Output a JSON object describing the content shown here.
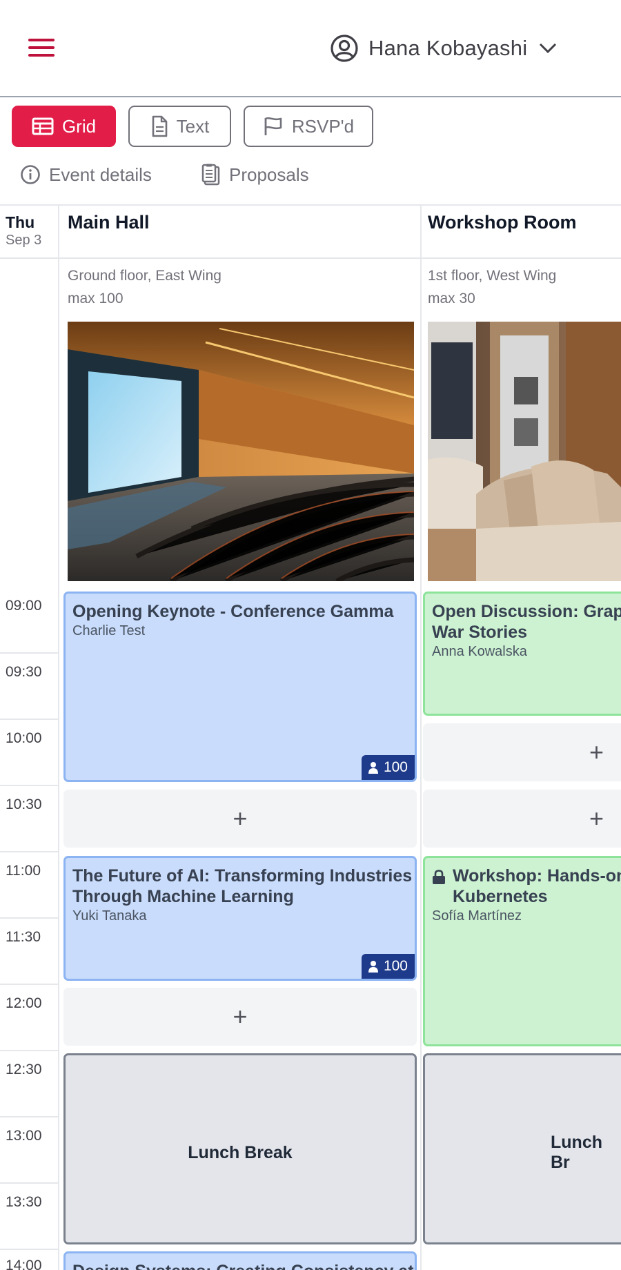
{
  "header": {
    "user_name": "Hana Kobayashi",
    "accent_color": "#e11d48"
  },
  "views": {
    "grid": "Grid",
    "text": "Text",
    "rsvpd": "RSVP'd"
  },
  "links": {
    "event_details": "Event details",
    "proposals": "Proposals"
  },
  "day": {
    "weekday": "Thu",
    "date": "Sep 3"
  },
  "rooms": [
    {
      "name": "Main Hall",
      "location": "Ground floor, East Wing",
      "capacity": "max 100",
      "photo": "auditorium"
    },
    {
      "name": "Workshop Room",
      "location": "1st floor, West Wing",
      "capacity": "max 30",
      "photo": "lounge"
    }
  ],
  "times": [
    "09:00",
    "09:30",
    "10:00",
    "10:30",
    "11:00",
    "11:30",
    "12:00",
    "12:30",
    "13:00",
    "13:30",
    "14:00"
  ],
  "events": {
    "keynote": {
      "title": "Opening Keynote - Conference Gamma",
      "speaker": "Charlie Test",
      "capacity": "100"
    },
    "discussion": {
      "title_line1": "Open Discussion: Graph",
      "title_line2": "War Stories",
      "speaker": "Anna Kowalska"
    },
    "future_ai": {
      "title_line1": "The Future of AI: Transforming Industries",
      "title_line2": "Through Machine Learning",
      "speaker": "Yuki Tanaka",
      "capacity": "100"
    },
    "workshop": {
      "title_line1": "Workshop: Hands-on",
      "title_line2": "Kubernetes",
      "speaker": "Sofía Martínez"
    },
    "lunch_main": {
      "title": "Lunch Break"
    },
    "lunch_workshop": {
      "title": "Lunch Br"
    },
    "design": {
      "title": "Design Systems: Creating Consistency at"
    }
  },
  "add_slot_symbol": "+"
}
